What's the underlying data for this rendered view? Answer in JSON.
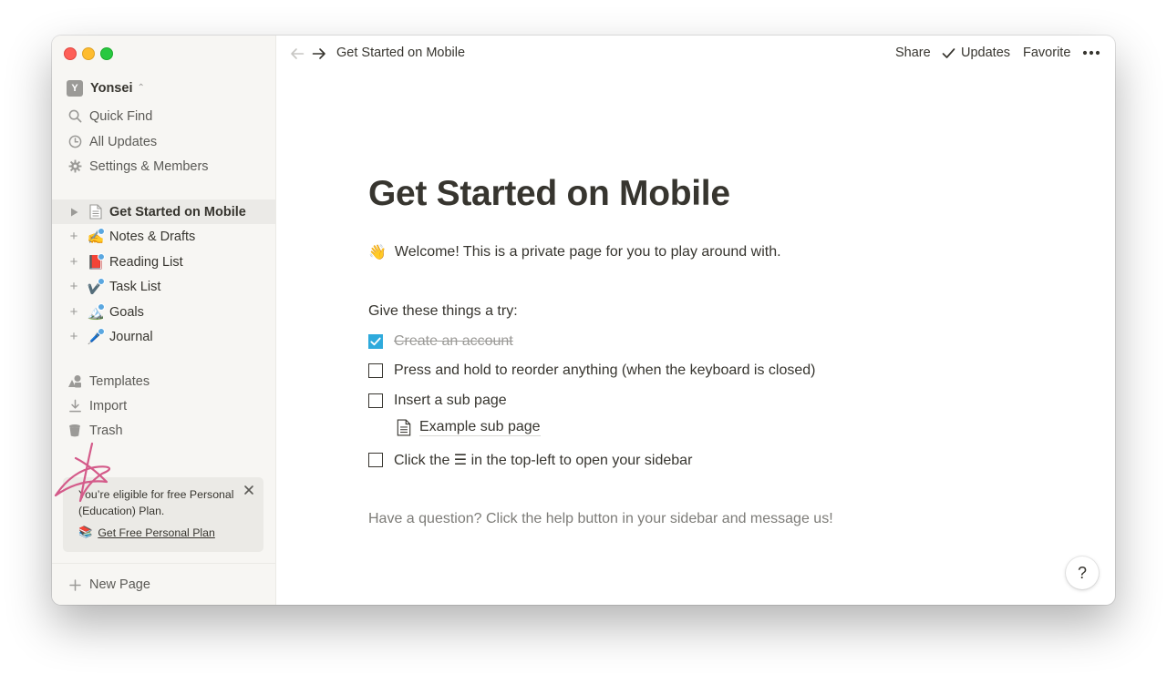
{
  "window": {
    "traffic_lights": [
      "close",
      "minimize",
      "zoom"
    ]
  },
  "sidebar": {
    "workspace": {
      "initial": "Y",
      "name": "Yonsei"
    },
    "nav": [
      {
        "label": "Quick Find",
        "icon": "search-icon"
      },
      {
        "label": "All Updates",
        "icon": "clock-icon"
      },
      {
        "label": "Settings & Members",
        "icon": "gear-icon"
      }
    ],
    "pages": [
      {
        "label": "Get Started on Mobile",
        "icon": "page-icon",
        "active": true
      },
      {
        "label": "Notes & Drafts",
        "icon": "✍️"
      },
      {
        "label": "Reading List",
        "icon": "📕"
      },
      {
        "label": "Task List",
        "icon": "✔️"
      },
      {
        "label": "Goals",
        "icon": "🏔️"
      },
      {
        "label": "Journal",
        "icon": "🖊️"
      }
    ],
    "bottom_nav": [
      {
        "label": "Templates",
        "icon": "templates-icon"
      },
      {
        "label": "Import",
        "icon": "download-icon"
      },
      {
        "label": "Trash",
        "icon": "trash-icon"
      }
    ],
    "promo": {
      "text": "You’re eligible for free Personal (Education) Plan.",
      "link_icon": "📚",
      "link_label": "Get Free Personal Plan"
    },
    "new_page_label": "New Page"
  },
  "topbar": {
    "breadcrumb": "Get Started on Mobile",
    "share_label": "Share",
    "updates_label": "Updates",
    "favorite_label": "Favorite"
  },
  "page": {
    "title": "Get Started on Mobile",
    "welcome_emoji": "👋",
    "welcome_text": "Welcome! This is a private page for you to play around with.",
    "try_heading": "Give these things a try:",
    "todos": [
      {
        "label": "Create an account",
        "checked": true
      },
      {
        "label": "Press and hold to reorder anything (when the keyboard is closed)",
        "checked": false
      },
      {
        "label": "Insert a sub page",
        "checked": false
      },
      {
        "label": "Click the ☰ in the top-left to open your sidebar",
        "checked": false
      }
    ],
    "subpage_label": "Example sub page",
    "question_text": "Have a question? Click the help button in your sidebar and message us!"
  },
  "help_button_label": "?",
  "colors": {
    "sidebar_bg": "#f7f6f3",
    "text": "#37352f",
    "muted": "#9b9a97",
    "checkbox_blue": "#2eaadc",
    "doodle_pink": "#d45b8a"
  }
}
